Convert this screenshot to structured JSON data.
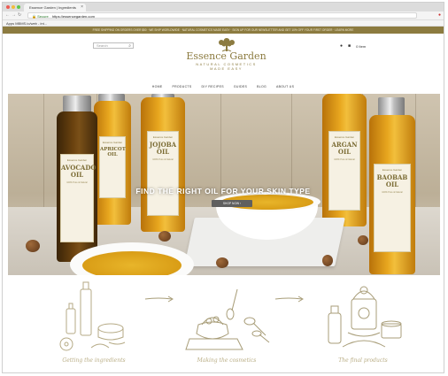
{
  "browser": {
    "tab_title": "Essence Garden | Ingredients",
    "url_secure": "Secure",
    "url": "https://essencegarden.com",
    "bookmarks": "Apps   MBMS.io/web - int..."
  },
  "site": {
    "announcement": "FREE SHIPPING ON ORDERS OVER $50 · WE SHIP WORLDWIDE · NATURAL COSMETICS MADE EASY · SIGN UP FOR OUR NEWSLETTER AND GET 10% OFF YOUR FIRST ORDER · LEARN MORE",
    "search_placeholder": "Search",
    "account_label": "0 Item",
    "logo_name": "Essence Garden",
    "logo_tagline_1": "NATURAL COSMETICS",
    "logo_tagline_2": "MADE EASY",
    "menu": [
      "HOME",
      "PRODUCTS",
      "DIY RECIPES",
      "GUIDES",
      "BLOG",
      "ABOUT US"
    ]
  },
  "hero": {
    "title": "FIND THE RIGHT OIL FOR YOUR SKIN TYPE",
    "button": "SHOP NOW",
    "bottles": [
      "AVOCADO OIL",
      "APRICOT OIL",
      "JOJOBA OIL",
      "ARGAN OIL",
      "BAOBAB OIL"
    ],
    "label_brand": "Essence Garden",
    "label_small": "100% Pure & Natural"
  },
  "steps": [
    {
      "caption": "Getting the ingredients"
    },
    {
      "caption": "Making the cosmetics"
    },
    {
      "caption": "The final products"
    }
  ],
  "colors": {
    "brand": "#8c7b40",
    "announcement_bg": "#8c7b40",
    "button_bg": "#5f5f5f"
  }
}
